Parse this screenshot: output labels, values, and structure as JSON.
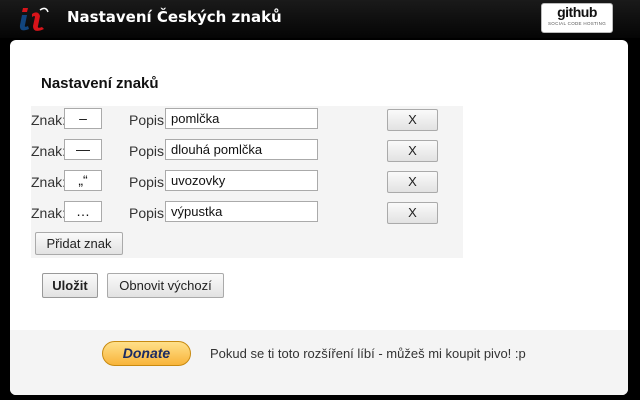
{
  "header": {
    "title": "Nastavení Českých znaků",
    "github": {
      "word": "github",
      "tagline": "SOCIAL CODE HOSTING"
    }
  },
  "settings": {
    "title": "Nastavení znaků",
    "char_label": "Znak:",
    "desc_label": "Popis:",
    "delete_label": "X",
    "rows": [
      {
        "char": "–",
        "desc": "pomlčka"
      },
      {
        "char": "—",
        "desc": "dlouhá pomlčka"
      },
      {
        "char": "„“",
        "desc": "uvozovky"
      },
      {
        "char": "…",
        "desc": "výpustka"
      }
    ],
    "add_label": "Přidat znak"
  },
  "actions": {
    "save_label": "Uložit",
    "reset_label": "Obnovit výchozí"
  },
  "footer": {
    "donate_label": "Donate",
    "message": "Pokud se ti toto rozšíření líbí - můžeš mi koupit pivo! :p"
  },
  "colors": {
    "header_bg": "#0a0a0a",
    "donate_bg": "#f8b43a",
    "donate_text": "#1b2b63",
    "logo_red": "#d7141a",
    "logo_blue": "#11457e"
  }
}
